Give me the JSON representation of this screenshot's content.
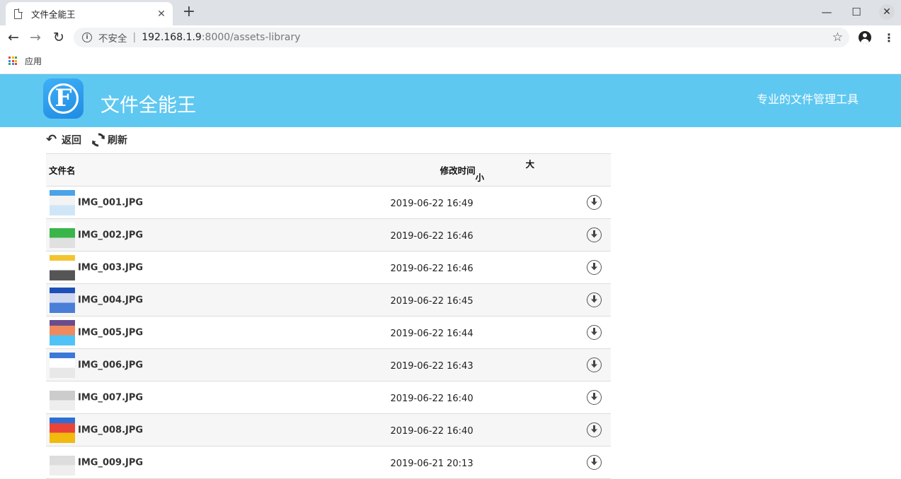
{
  "browser": {
    "tab_title": "文件全能王",
    "security_label": "不安全",
    "url_host": "192.168.1.9",
    "url_path": ":8000/assets-library",
    "bookmarks_apps_label": "应用"
  },
  "header": {
    "logo_letter": "F",
    "app_name": "文件全能王",
    "slogan": "专业的文件管理工具"
  },
  "actions": {
    "back_label": "返回",
    "refresh_label": "刷新"
  },
  "table": {
    "columns": [
      "文件名",
      "修改时间",
      "大小"
    ],
    "rows": [
      {
        "name": "IMG_001.JPG",
        "modified": "2019-06-22 16:49",
        "size": ""
      },
      {
        "name": "IMG_002.JPG",
        "modified": "2019-06-22 16:46",
        "size": ""
      },
      {
        "name": "IMG_003.JPG",
        "modified": "2019-06-22 16:46",
        "size": ""
      },
      {
        "name": "IMG_004.JPG",
        "modified": "2019-06-22 16:45",
        "size": ""
      },
      {
        "name": "IMG_005.JPG",
        "modified": "2019-06-22 16:44",
        "size": ""
      },
      {
        "name": "IMG_006.JPG",
        "modified": "2019-06-22 16:43",
        "size": ""
      },
      {
        "name": "IMG_007.JPG",
        "modified": "2019-06-22 16:40",
        "size": ""
      },
      {
        "name": "IMG_008.JPG",
        "modified": "2019-06-22 16:40",
        "size": ""
      },
      {
        "name": "IMG_009.JPG",
        "modified": "2019-06-21 20:13",
        "size": ""
      }
    ]
  },
  "colors": {
    "banner": "#5ec8f1",
    "logo_bg": "#1f8be3",
    "tabstrip": "#dee1e6"
  }
}
